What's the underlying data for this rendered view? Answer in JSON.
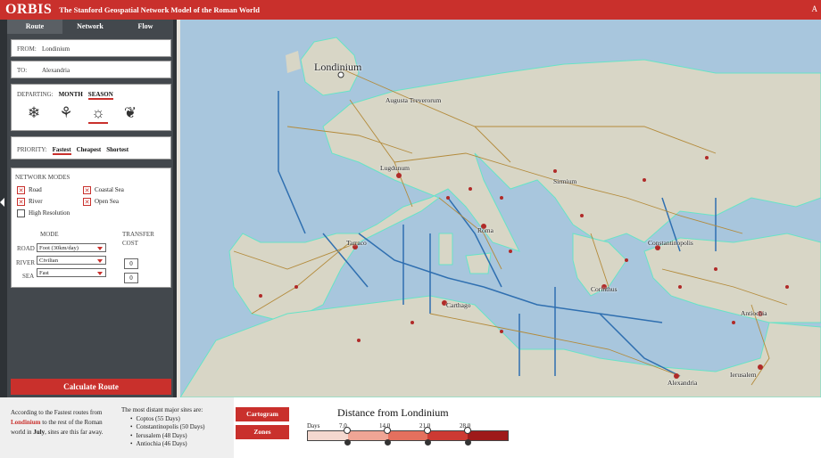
{
  "header": {
    "brand": "ORBIS",
    "subtitle": "The Stanford Geospatial Network Model of the Roman World",
    "corner": "A"
  },
  "tabs": [
    {
      "label": "Route"
    },
    {
      "label": "Network"
    },
    {
      "label": "Flow"
    }
  ],
  "route": {
    "from_label": "FROM:",
    "from_value": "Londinium",
    "to_label": "TO:",
    "to_value": "Alexandria"
  },
  "departing": {
    "label": "DEPARTING:",
    "month": "MONTH",
    "season": "SEASON",
    "icons": [
      "snowflake-icon",
      "flower-icon",
      "sun-icon",
      "leaf-icon"
    ]
  },
  "priority": {
    "label": "PRIORITY:",
    "fastest": "Fastest",
    "cheapest": "Cheapest",
    "shortest": "Shortest"
  },
  "network_modes": {
    "title": "NETWORK MODES",
    "road": "Road",
    "coastal_sea": "Coastal Sea",
    "river": "River",
    "open_sea": "Open Sea",
    "high_res": "High Resolution",
    "mode_header": "MODE",
    "transfer_header_1": "TRANSFER",
    "transfer_header_2": "COST",
    "road_label": "ROAD",
    "river_label": "RIVER",
    "sea_label": "SEA",
    "road_mode": "Foot (30km/day)",
    "river_mode": "Civilian",
    "sea_mode": "Fast",
    "river_cost": "0",
    "sea_cost": "0"
  },
  "calc_button": "Calculate Route",
  "map": {
    "labels": {
      "londinium": "Londinium",
      "augusta": "Augusta Treverorum",
      "lugdunum": "Lugdunum",
      "sirmium": "Sirmium",
      "roma": "Roma",
      "tarraco": "Tarraco",
      "constantinopolis": "Constantinopolis",
      "corinthus": "Corinthus",
      "carthago": "Carthago",
      "antiochia": "Antiochia",
      "alexandria": "Alexandria",
      "ierusalem": "Ierusalem"
    }
  },
  "info": {
    "p1": "According to the Fastest routes from",
    "origin": "Londinium",
    "p2": "to the rest of the Roman world in",
    "month": "July",
    "p3": ", sites are this far away.",
    "sites_title": "The most distant major sites are:",
    "sites": [
      "Coptos (55 Days)",
      "Constantinopolis (50 Days)",
      "Ierusalem (48 Days)",
      "Antiochia (46 Days)"
    ]
  },
  "buttons": {
    "cartogram": "Cartogram",
    "zones": "Zones"
  },
  "legend": {
    "title": "Distance from Londinium",
    "unit": "Days",
    "ticks": [
      "7.0",
      "14.0",
      "21.0",
      "28.0"
    ],
    "colors": [
      "#f4d8cf",
      "#efa595",
      "#e4705e",
      "#cd3a33",
      "#9e1a1a"
    ]
  }
}
